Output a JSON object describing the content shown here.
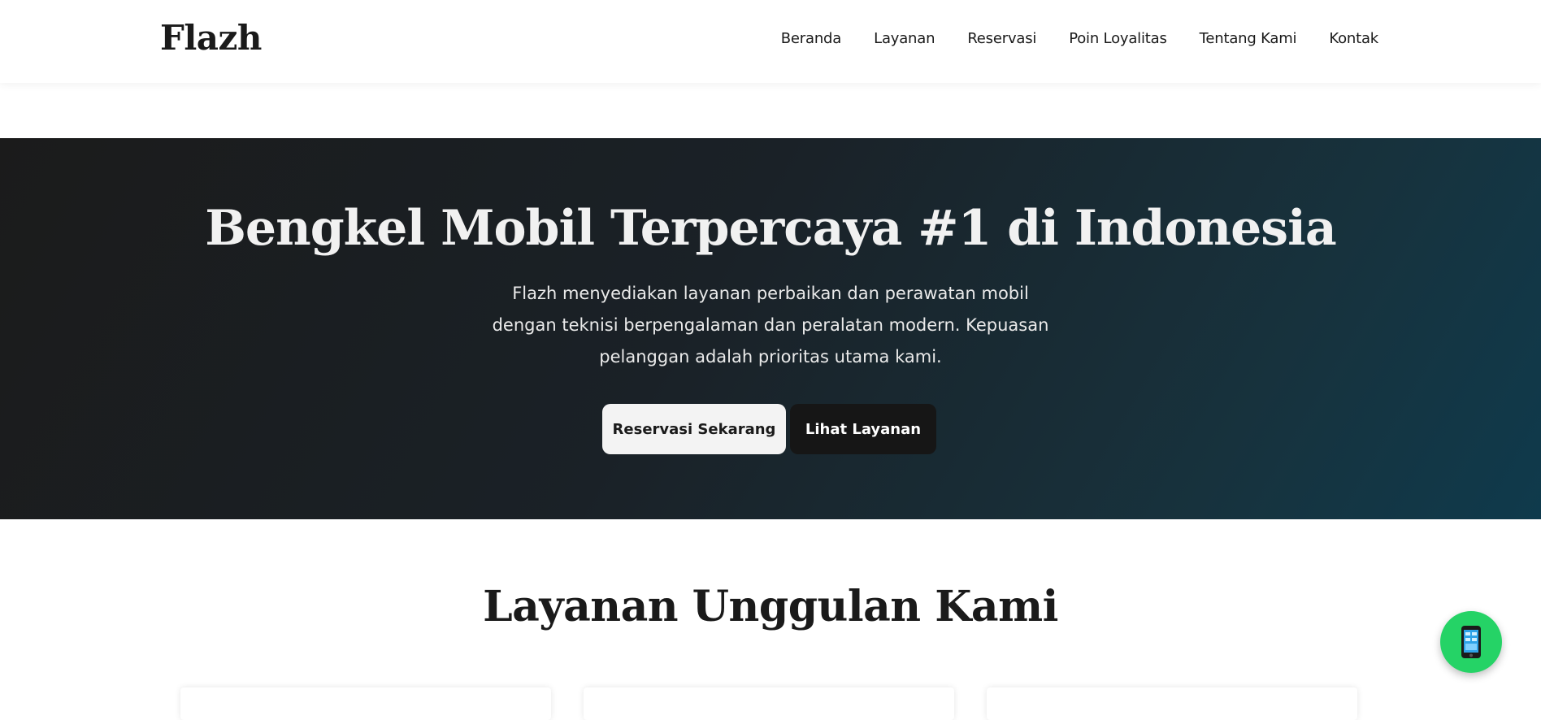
{
  "navbar": {
    "brand": "Flazh",
    "links": [
      {
        "label": "Beranda"
      },
      {
        "label": "Layanan"
      },
      {
        "label": "Reservasi"
      },
      {
        "label": "Poin Loyalitas"
      },
      {
        "label": "Tentang Kami"
      },
      {
        "label": "Kontak"
      }
    ]
  },
  "hero": {
    "title": "Bengkel Mobil Terpercaya #1 di Indonesia",
    "subtitle": "Flazh menyediakan layanan perbaikan dan perawatan mobil dengan teknisi berpengalaman dan peralatan modern. Kepuasan pelanggan adalah prioritas utama kami.",
    "primary_button": "Reservasi Sekarang",
    "secondary_button": "Lihat Layanan"
  },
  "services": {
    "title": "Layanan Unggulan Kami"
  },
  "floating_button": {
    "icon": "mobile-phone-icon",
    "color": "#25d366"
  },
  "colors": {
    "hero_gradient_start": "#1b1b1b",
    "hero_gradient_end": "#0f3a4c",
    "text_dark": "#1a1a1a"
  }
}
